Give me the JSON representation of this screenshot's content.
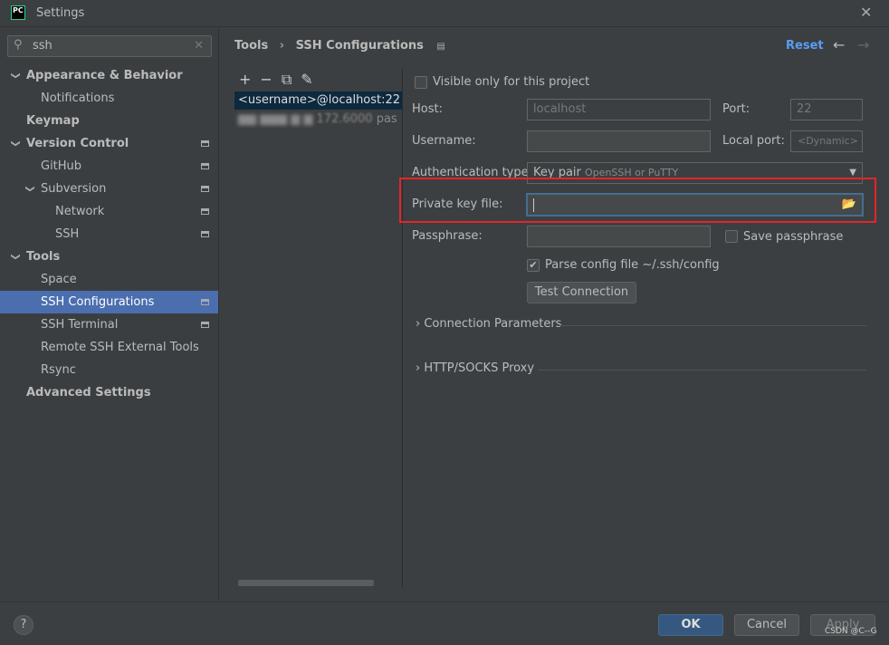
{
  "window": {
    "title": "Settings",
    "logo": "PC"
  },
  "search": {
    "value": "ssh"
  },
  "tree": [
    {
      "label": "Appearance & Behavior",
      "level": 0,
      "expanded": true,
      "bold": true
    },
    {
      "label": "Notifications",
      "level": 1
    },
    {
      "label": "Keymap",
      "level": 0,
      "bold": true
    },
    {
      "label": "Version Control",
      "level": 0,
      "expanded": true,
      "bold": true,
      "pin": true
    },
    {
      "label": "GitHub",
      "level": 1,
      "pin": true
    },
    {
      "label": "Subversion",
      "level": 1,
      "expanded": true,
      "pin": true
    },
    {
      "label": "Network",
      "level": 2,
      "pin": true
    },
    {
      "label": "SSH",
      "level": 2,
      "pin": true
    },
    {
      "label": "Tools",
      "level": 0,
      "expanded": true,
      "bold": true
    },
    {
      "label": "Space",
      "level": 1
    },
    {
      "label": "SSH Configurations",
      "level": 1,
      "pin": true,
      "selected": true
    },
    {
      "label": "SSH Terminal",
      "level": 1,
      "pin": true
    },
    {
      "label": "Remote SSH External Tools",
      "level": 1
    },
    {
      "label": "Rsync",
      "level": 1
    },
    {
      "label": "Advanced Settings",
      "level": 0,
      "bold": true
    }
  ],
  "breadcrumb": {
    "parent": "Tools",
    "current": "SSH Configurations"
  },
  "header": {
    "reset": "Reset"
  },
  "configs": [
    {
      "name": "<username>@localhost:22",
      "type": "key"
    },
    {
      "name": "172.6000",
      "type": "pas"
    }
  ],
  "form": {
    "visible_only": "Visible only for this project",
    "host_label": "Host:",
    "host": "localhost",
    "port_label": "Port:",
    "port": "22",
    "username_label": "Username:",
    "username": "",
    "local_port_label": "Local port:",
    "local_port": "<Dynamic>",
    "auth_label": "Authentication type:",
    "auth_value": "Key pair",
    "auth_hint": "OpenSSH or PuTTY",
    "key_label": "Private key file:",
    "key_value": "",
    "pass_label": "Passphrase:",
    "save_pass": "Save passphrase",
    "parse_config": "Parse config file ~/.ssh/config",
    "parse_checked": true,
    "test": "Test Connection",
    "conn_params": "Connection Parameters",
    "proxy": "HTTP/SOCKS Proxy"
  },
  "footer": {
    "help": "?",
    "ok": "OK",
    "cancel": "Cancel",
    "apply": "Apply",
    "watermark": "CSDN @C--G"
  },
  "colors": {
    "accent": "#4b6eaf",
    "highlight": "#e0262a",
    "link": "#589df6"
  }
}
